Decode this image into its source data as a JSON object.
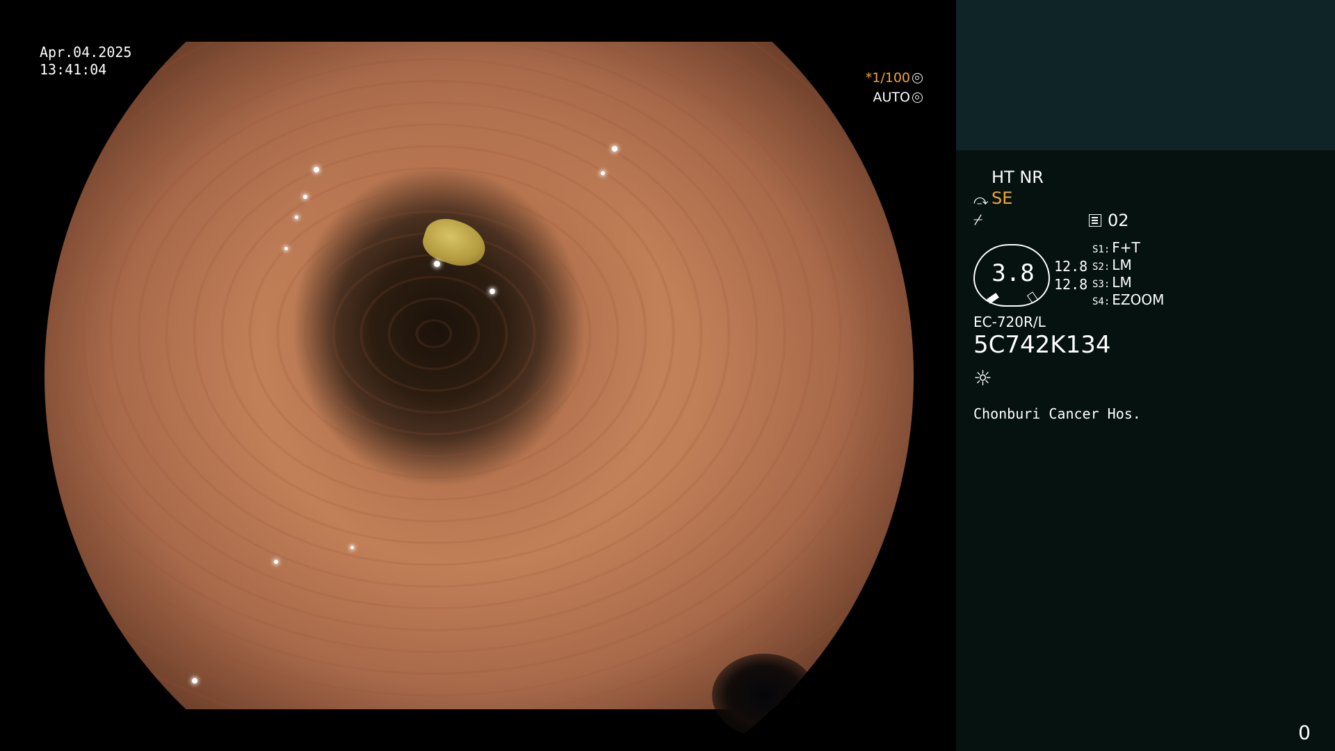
{
  "overlay": {
    "date": "Apr.04.2025",
    "time": "13:41:04",
    "shutter": "*1/100",
    "iris": "AUTO"
  },
  "icons": {
    "shutter": "aperture-icon",
    "iris": "iris-icon",
    "se": "structure-enhancement-icon",
    "enhancement": "enhancement-icon",
    "memo": "memo-icon",
    "light": "light-icon"
  },
  "panel": {
    "modes": "HT NR",
    "se_label": "SE",
    "memo_number": "02",
    "dial_value": "3.8",
    "value1": "12.8",
    "value2": "12.8",
    "switches": [
      {
        "key": "S1:",
        "value": "F+T"
      },
      {
        "key": "S2:",
        "value": "LM"
      },
      {
        "key": "S3:",
        "value": "LM"
      },
      {
        "key": "S4:",
        "value": "EZOOM"
      }
    ],
    "model": "EC-720R/L",
    "serial": "5C742K134",
    "hospital": "Chonburi Cancer Hos.",
    "counter": "0"
  },
  "colors": {
    "accent": "#f0a830",
    "panel_bg": "#061210",
    "panel_top": "#0e2426"
  }
}
